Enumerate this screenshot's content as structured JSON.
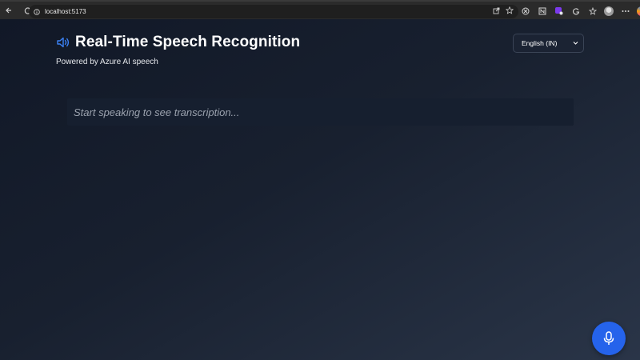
{
  "browser": {
    "url": "localhost:5173"
  },
  "app": {
    "title": "Real-Time Speech Recognition",
    "subtitle": "Powered by Azure AI speech",
    "language_selected": "English (IN)",
    "transcript_placeholder": "Start speaking to see transcription...",
    "colors": {
      "accent_blue": "#2563eb",
      "speaker_icon": "#3b82f6",
      "background_top": "#111827",
      "background_bottom": "#2a3548"
    },
    "icons": [
      "speaker-icon",
      "microphone-icon",
      "chevron-down-icon"
    ]
  }
}
